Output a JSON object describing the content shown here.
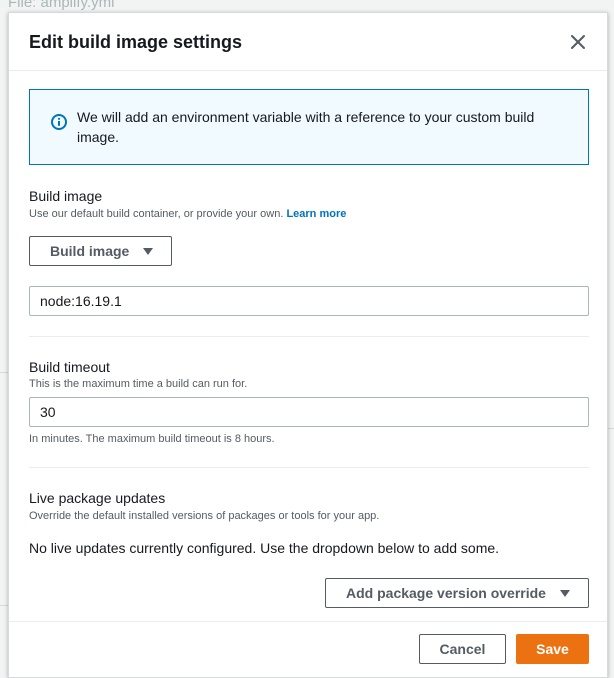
{
  "background": {
    "file_label": "File: amplify.yml"
  },
  "modal": {
    "title": "Edit build image settings",
    "close_icon": "close-icon"
  },
  "info": {
    "icon": "info-icon",
    "text": "We will add an environment variable with a reference to your custom build image."
  },
  "build_image": {
    "label": "Build image",
    "description": "Use our default build container, or provide your own.",
    "learn_more": "Learn more",
    "dropdown_label": "Build image",
    "value": "node:16.19.1"
  },
  "build_timeout": {
    "label": "Build timeout",
    "description": "This is the maximum time a build can run for.",
    "value": "30",
    "hint": "In minutes. The maximum build timeout is 8 hours."
  },
  "live_updates": {
    "label": "Live package updates",
    "description": "Override the default installed versions of packages or tools for your app.",
    "status": "No live updates currently configured. Use the dropdown below to add some.",
    "override_button": "Add package version override"
  },
  "footer": {
    "cancel": "Cancel",
    "save": "Save"
  },
  "colors": {
    "accent": "#ec7211",
    "link": "#0073bb",
    "info_bg": "#f1faff"
  }
}
